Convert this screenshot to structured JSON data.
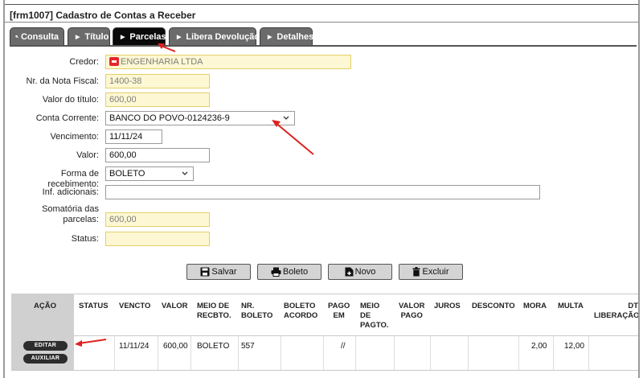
{
  "window": {
    "title": "[frm1007] Cadastro de Contas a Receber"
  },
  "tabs": [
    {
      "label": "Consulta",
      "icon": "search-icon",
      "active": false
    },
    {
      "label": "Título",
      "active": false
    },
    {
      "label": "Parcelas",
      "active": true
    },
    {
      "label": "Libera Devolução",
      "active": false
    },
    {
      "label": "Detalhes",
      "active": false
    }
  ],
  "form": {
    "credor": {
      "label": "Credor:",
      "value": "ENGENHARIA LTDA"
    },
    "nota_fiscal": {
      "label": "Nr. da Nota Fiscal:",
      "value": "1400-38"
    },
    "valor_titulo": {
      "label": "Valor do título:",
      "value": "600,00"
    },
    "conta_corrente": {
      "label": "Conta Corrente:",
      "value": "BANCO DO POVO-0124236-9"
    },
    "vencimento": {
      "label": "Vencimento:",
      "value": "11/11/24"
    },
    "valor": {
      "label": "Valor:",
      "value": "600,00"
    },
    "forma_recebimento": {
      "label": "Forma de recebimento:",
      "value": "BOLETO"
    },
    "inf_adicionais": {
      "label": "Inf. adicionais:",
      "value": ""
    },
    "somatoria": {
      "label_line1": "Somatória das",
      "label_line2": "parcelas:",
      "value": "600,00"
    },
    "status": {
      "label": "Status:",
      "value": ""
    }
  },
  "buttons": {
    "salvar": "Salvar",
    "boleto": "Boleto",
    "novo": "Novo",
    "excluir": "Excluir"
  },
  "grid": {
    "headers": {
      "acao": "AÇÃO",
      "status": "STATUS",
      "vencto": "VENCTO",
      "valor": "VALOR",
      "meio_recbto": [
        "MEIO DE",
        "RECBTO."
      ],
      "nr_boleto": [
        "NR.",
        "BOLETO"
      ],
      "boleto_acordo": [
        "BOLETO",
        "ACORDO"
      ],
      "pago_em": [
        "PAGO",
        "EM"
      ],
      "meio_pagto": [
        "MEIO",
        "DE",
        "PAGTO."
      ],
      "valor_pago": [
        "VALOR",
        "PAGO"
      ],
      "juros": "JUROS",
      "desconto": "DESCONTO",
      "mora": "MORA",
      "multa": "MULTA",
      "dt_liberacao": [
        "DT",
        "LIBERAÇÃO"
      ]
    },
    "rows": [
      {
        "actions": {
          "editar": "EDITAR",
          "auxiliar": "AUXILIAR"
        },
        "status": "",
        "vencto": "11/11/24",
        "valor": "600,00",
        "meio_recbto": "BOLETO",
        "nr_boleto": "557",
        "boleto_acordo": "",
        "pago_em": "//",
        "meio_pagto": "",
        "valor_pago": "",
        "juros": "",
        "desconto": "",
        "mora": "2,00",
        "multa": "12,00",
        "dt_liberacao": ""
      }
    ]
  },
  "colors": {
    "tab_bg": "#6b6b6b",
    "tab_active_bg": "#0a0a0a",
    "readonly_field_bg": "#fdf8d3",
    "readonly_field_border": "#e3cf6a",
    "annotation_arrow": "#e02020"
  }
}
